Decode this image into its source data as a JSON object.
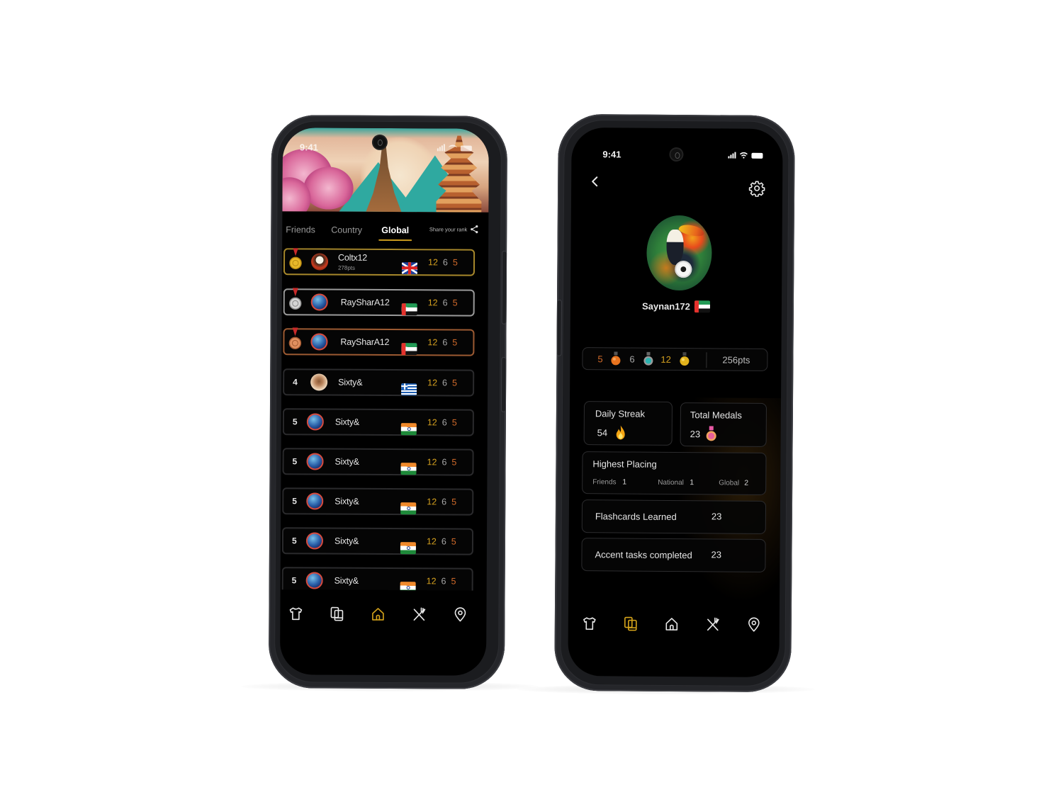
{
  "left_phone": {
    "status_bar": {
      "time": "9:41"
    },
    "banner": {
      "illustration": "travel-landmarks-banner"
    },
    "tabs": [
      {
        "label": "Friends",
        "active": false
      },
      {
        "label": "Country",
        "active": false
      },
      {
        "label": "Global",
        "active": true
      }
    ],
    "share": {
      "label": "Share your rank",
      "icon": "share-icon"
    },
    "leaderboard": [
      {
        "rank": "1",
        "medal": "gold",
        "name": "Coltx12",
        "points": "278pts",
        "flag": "UK",
        "gold": "12",
        "silver": "6",
        "bronze": "5"
      },
      {
        "rank": "2",
        "medal": "silver",
        "name": "RaySharA12",
        "flag": "UAE",
        "gold": "12",
        "silver": "6",
        "bronze": "5"
      },
      {
        "rank": "3",
        "medal": "bronze",
        "name": "RaySharA12",
        "flag": "UAE",
        "gold": "12",
        "silver": "6",
        "bronze": "5"
      },
      {
        "rank": "4",
        "name": "Sixty&",
        "flag": "Greece",
        "gold": "12",
        "silver": "6",
        "bronze": "5"
      },
      {
        "rank": "5",
        "name": "Sixty&",
        "flag": "India",
        "gold": "12",
        "silver": "6",
        "bronze": "5"
      },
      {
        "rank": "5",
        "name": "Sixty&",
        "flag": "India",
        "gold": "12",
        "silver": "6",
        "bronze": "5"
      },
      {
        "rank": "5",
        "name": "Sixty&",
        "flag": "India",
        "gold": "12",
        "silver": "6",
        "bronze": "5"
      },
      {
        "rank": "5",
        "name": "Sixty&",
        "flag": "India",
        "gold": "12",
        "silver": "6",
        "bronze": "5"
      },
      {
        "rank": "5",
        "name": "Sixty&",
        "flag": "India",
        "gold": "12",
        "silver": "6",
        "bronze": "5"
      }
    ],
    "nav": [
      {
        "icon": "shirt-icon",
        "active": false
      },
      {
        "icon": "flashcards-icon",
        "active": false
      },
      {
        "icon": "home-icon",
        "active": true
      },
      {
        "icon": "food-icon",
        "active": false
      },
      {
        "icon": "location-pin-icon",
        "active": false
      }
    ]
  },
  "right_phone": {
    "status_bar": {
      "time": "9:41"
    },
    "header": {
      "back_icon": "chevron-left-icon",
      "settings_icon": "gear-icon"
    },
    "profile": {
      "username": "Saynan172",
      "flag": "UAE"
    },
    "medals": {
      "bronze": "5",
      "silver": "6",
      "gold": "12",
      "points": "256pts"
    },
    "daily_streak": {
      "title": "Daily Streak",
      "value": "54"
    },
    "total_medals": {
      "title": "Total Medals",
      "value": "23"
    },
    "highest_placing": {
      "title": "Highest Placing",
      "friends_label": "Friends",
      "friends_value": "1",
      "national_label": "National",
      "national_value": "1",
      "global_label": "Global",
      "global_value": "2"
    },
    "flashcards": {
      "label": "Flashcards Learned",
      "value": "23"
    },
    "accent_tasks": {
      "label": "Accent tasks completed",
      "value": "23"
    },
    "nav": [
      {
        "icon": "shirt-icon",
        "active": false
      },
      {
        "icon": "flashcards-icon",
        "active": true
      },
      {
        "icon": "home-icon",
        "active": false
      },
      {
        "icon": "food-icon",
        "active": false
      },
      {
        "icon": "location-pin-icon",
        "active": false
      }
    ]
  },
  "colors": {
    "accent": "#d7a51b",
    "gold": "#d4a01f",
    "silver": "#a8a8a8",
    "bronze": "#d06a2a",
    "background": "#000000",
    "frame": "#2b2c30"
  }
}
